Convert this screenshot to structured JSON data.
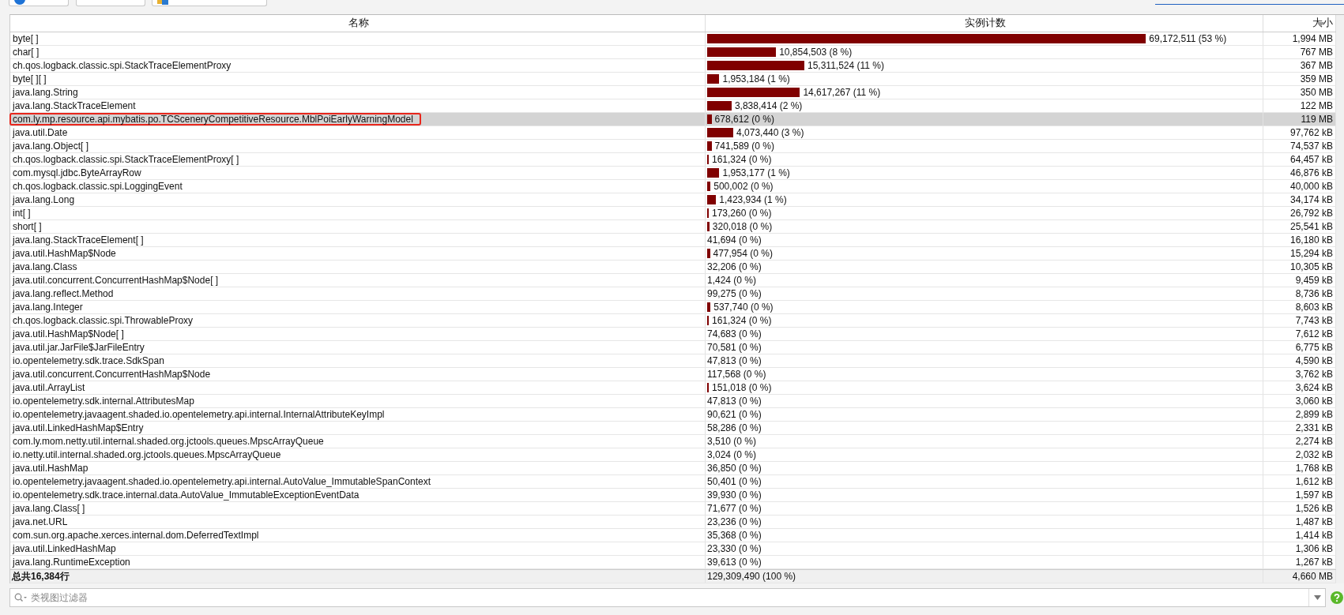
{
  "table": {
    "columns": [
      {
        "label": "名称"
      },
      {
        "label": "实例计数"
      },
      {
        "label": "大小",
        "sorted": true
      }
    ],
    "rows": [
      {
        "name": "byte[ ]",
        "count": "69,172,511 (53 %)",
        "level": 0.79,
        "size": "1,994 MB",
        "selected": false,
        "marked": false
      },
      {
        "name": "char[ ]",
        "count": "10,854,503 (8 %)",
        "level": 0.124,
        "size": "767 MB",
        "selected": false,
        "marked": false
      },
      {
        "name": "ch.qos.logback.classic.spi.StackTraceElementProxy",
        "count": "15,311,524 (11 %)",
        "level": 0.175,
        "size": "367 MB",
        "selected": false,
        "marked": false
      },
      {
        "name": "byte[ ][ ]",
        "count": "1,953,184 (1 %)",
        "level": 0.022,
        "size": "359 MB",
        "selected": false,
        "marked": false
      },
      {
        "name": "java.lang.String",
        "count": "14,617,267 (11 %)",
        "level": 0.167,
        "size": "350 MB",
        "selected": false,
        "marked": false
      },
      {
        "name": "java.lang.StackTraceElement",
        "count": "3,838,414 (2 %)",
        "level": 0.044,
        "size": "122 MB",
        "selected": false,
        "marked": false
      },
      {
        "name": "com.ly.mp.resource.api.mybatis.po.TCSceneryCompetitiveResource.MblPoiEarlyWarningModel",
        "count": "678,612 (0 %)",
        "level": 0.008,
        "size": "119 MB",
        "selected": true,
        "marked": true
      },
      {
        "name": "java.util.Date",
        "count": "4,073,440 (3 %)",
        "level": 0.047,
        "size": "97,762 kB",
        "selected": false,
        "marked": false
      },
      {
        "name": "java.lang.Object[ ]",
        "count": "741,589 (0 %)",
        "level": 0.008,
        "size": "74,537 kB",
        "selected": false,
        "marked": false
      },
      {
        "name": "ch.qos.logback.classic.spi.StackTraceElementProxy[ ]",
        "count": "161,324 (0 %)",
        "level": 0.002,
        "size": "64,457 kB",
        "selected": false,
        "marked": false
      },
      {
        "name": "com.mysql.jdbc.ByteArrayRow",
        "count": "1,953,177 (1 %)",
        "level": 0.022,
        "size": "46,876 kB",
        "selected": false,
        "marked": false
      },
      {
        "name": "ch.qos.logback.classic.spi.LoggingEvent",
        "count": "500,002 (0 %)",
        "level": 0.006,
        "size": "40,000 kB",
        "selected": false,
        "marked": false
      },
      {
        "name": "java.lang.Long",
        "count": "1,423,934 (1 %)",
        "level": 0.016,
        "size": "34,174 kB",
        "selected": false,
        "marked": false
      },
      {
        "name": "int[ ]",
        "count": "173,260 (0 %)",
        "level": 0.002,
        "size": "26,792 kB",
        "selected": false,
        "marked": false
      },
      {
        "name": "short[ ]",
        "count": "320,018 (0 %)",
        "level": 0.004,
        "size": "25,541 kB",
        "selected": false,
        "marked": false
      },
      {
        "name": "java.lang.StackTraceElement[ ]",
        "count": "41,694 (0 %)",
        "level": 0,
        "size": "16,180 kB",
        "selected": false,
        "marked": false
      },
      {
        "name": "java.util.HashMap$Node",
        "count": "477,954 (0 %)",
        "level": 0.005,
        "size": "15,294 kB",
        "selected": false,
        "marked": false
      },
      {
        "name": "java.lang.Class",
        "count": "32,206 (0 %)",
        "level": 0,
        "size": "10,305 kB",
        "selected": false,
        "marked": false
      },
      {
        "name": "java.util.concurrent.ConcurrentHashMap$Node[ ]",
        "count": "1,424 (0 %)",
        "level": 0,
        "size": "9,459 kB",
        "selected": false,
        "marked": false
      },
      {
        "name": "java.lang.reflect.Method",
        "count": "99,275 (0 %)",
        "level": 0,
        "size": "8,736 kB",
        "selected": false,
        "marked": false
      },
      {
        "name": "java.lang.Integer",
        "count": "537,740 (0 %)",
        "level": 0.006,
        "size": "8,603 kB",
        "selected": false,
        "marked": false
      },
      {
        "name": "ch.qos.logback.classic.spi.ThrowableProxy",
        "count": "161,324 (0 %)",
        "level": 0.002,
        "size": "7,743 kB",
        "selected": false,
        "marked": false
      },
      {
        "name": "java.util.HashMap$Node[ ]",
        "count": "74,683 (0 %)",
        "level": 0,
        "size": "7,612 kB",
        "selected": false,
        "marked": false
      },
      {
        "name": "java.util.jar.JarFile$JarFileEntry",
        "count": "70,581 (0 %)",
        "level": 0,
        "size": "6,775 kB",
        "selected": false,
        "marked": false
      },
      {
        "name": "io.opentelemetry.sdk.trace.SdkSpan",
        "count": "47,813 (0 %)",
        "level": 0,
        "size": "4,590 kB",
        "selected": false,
        "marked": false
      },
      {
        "name": "java.util.concurrent.ConcurrentHashMap$Node",
        "count": "117,568 (0 %)",
        "level": 0,
        "size": "3,762 kB",
        "selected": false,
        "marked": false
      },
      {
        "name": "java.util.ArrayList",
        "count": "151,018 (0 %)",
        "level": 0.002,
        "size": "3,624 kB",
        "selected": false,
        "marked": false
      },
      {
        "name": "io.opentelemetry.sdk.internal.AttributesMap",
        "count": "47,813 (0 %)",
        "level": 0,
        "size": "3,060 kB",
        "selected": false,
        "marked": false
      },
      {
        "name": "io.opentelemetry.javaagent.shaded.io.opentelemetry.api.internal.InternalAttributeKeyImpl",
        "count": "90,621 (0 %)",
        "level": 0,
        "size": "2,899 kB",
        "selected": false,
        "marked": false
      },
      {
        "name": "java.util.LinkedHashMap$Entry",
        "count": "58,286 (0 %)",
        "level": 0,
        "size": "2,331 kB",
        "selected": false,
        "marked": false
      },
      {
        "name": "com.ly.mom.netty.util.internal.shaded.org.jctools.queues.MpscArrayQueue",
        "count": "3,510 (0 %)",
        "level": 0,
        "size": "2,274 kB",
        "selected": false,
        "marked": false
      },
      {
        "name": "io.netty.util.internal.shaded.org.jctools.queues.MpscArrayQueue",
        "count": "3,024 (0 %)",
        "level": 0,
        "size": "2,032 kB",
        "selected": false,
        "marked": false
      },
      {
        "name": "java.util.HashMap",
        "count": "36,850 (0 %)",
        "level": 0,
        "size": "1,768 kB",
        "selected": false,
        "marked": false
      },
      {
        "name": "io.opentelemetry.javaagent.shaded.io.opentelemetry.api.internal.AutoValue_ImmutableSpanContext",
        "count": "50,401 (0 %)",
        "level": 0,
        "size": "1,612 kB",
        "selected": false,
        "marked": false
      },
      {
        "name": "io.opentelemetry.sdk.trace.internal.data.AutoValue_ImmutableExceptionEventData",
        "count": "39,930 (0 %)",
        "level": 0,
        "size": "1,597 kB",
        "selected": false,
        "marked": false
      },
      {
        "name": "java.lang.Class[ ]",
        "count": "71,677 (0 %)",
        "level": 0,
        "size": "1,526 kB",
        "selected": false,
        "marked": false
      },
      {
        "name": "java.net.URL",
        "count": "23,236 (0 %)",
        "level": 0,
        "size": "1,487 kB",
        "selected": false,
        "marked": false
      },
      {
        "name": "com.sun.org.apache.xerces.internal.dom.DeferredTextImpl",
        "count": "35,368 (0 %)",
        "level": 0,
        "size": "1,414 kB",
        "selected": false,
        "marked": false
      },
      {
        "name": "java.util.LinkedHashMap",
        "count": "23,330 (0 %)",
        "level": 0,
        "size": "1,306 kB",
        "selected": false,
        "marked": false
      },
      {
        "name": "java.lang.RuntimeException",
        "count": "39,613 (0 %)",
        "level": 0,
        "size": "1,267 kB",
        "selected": false,
        "marked": false
      }
    ],
    "total": {
      "name": "总共16,384行",
      "count": "129,309,490 (100 %)",
      "size": "4,660 MB"
    }
  },
  "filter": {
    "placeholder": "类视图过滤器"
  }
}
